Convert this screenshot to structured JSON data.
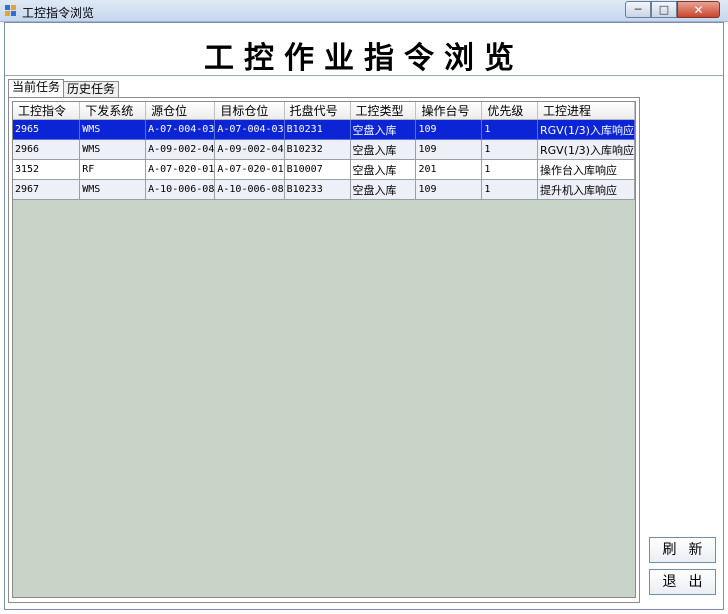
{
  "window": {
    "title": "工控指令浏览",
    "minimize_icon": "minimize-icon",
    "maximize_icon": "maximize-icon",
    "close_icon": "close-icon",
    "app_icon": "app-grid-icon"
  },
  "page": {
    "title": "工控作业指令浏览"
  },
  "tabs": [
    {
      "label": "当前任务",
      "active": true
    },
    {
      "label": "历史任务",
      "active": false
    }
  ],
  "grid": {
    "columns": [
      "工控指令",
      "下发系统",
      "源仓位",
      "目标仓位",
      "托盘代号",
      "工控类型",
      "操作台号",
      "优先级",
      "工控进程"
    ],
    "rows": [
      [
        "2965",
        "WMS",
        "A-07-004-03",
        "A-07-004-03",
        "B10231",
        "空盘入库",
        "109",
        "1",
        "RGV(1/3)入库响应"
      ],
      [
        "2966",
        "WMS",
        "A-09-002-04",
        "A-09-002-04",
        "B10232",
        "空盘入库",
        "109",
        "1",
        "RGV(1/3)入库响应"
      ],
      [
        "3152",
        "RF",
        "A-07-020-01",
        "A-07-020-01",
        "B10007",
        "空盘入库",
        "201",
        "1",
        "操作台入库响应"
      ],
      [
        "2967",
        "WMS",
        "A-10-006-08",
        "A-10-006-08",
        "B10233",
        "空盘入库",
        "109",
        "1",
        "提升机入库响应"
      ]
    ],
    "selected_row": 0
  },
  "buttons": {
    "refresh": "刷新",
    "exit": "退出"
  },
  "colors": {
    "selection": "#0a24d6",
    "grid_background": "#c9d4c8",
    "alt_row": "#eef0f7"
  }
}
